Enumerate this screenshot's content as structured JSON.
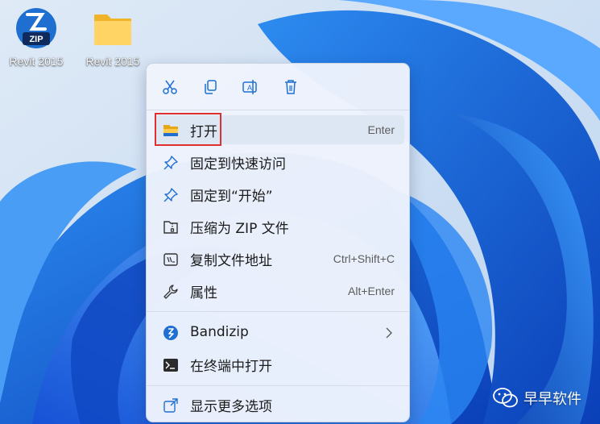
{
  "desktop": {
    "icons": [
      {
        "label": "Revit 2015",
        "icon": "zip-archive-icon"
      },
      {
        "label": "Revit 2015",
        "icon": "folder-icon"
      }
    ]
  },
  "toolbar": {
    "cut": "cut-icon",
    "copy": "copy-icon",
    "rename": "rename-icon",
    "delete": "delete-icon"
  },
  "menu": {
    "open": {
      "label": "打开",
      "shortcut": "Enter",
      "icon": "folder-open-icon"
    },
    "pin_quick": {
      "label": "固定到快速访问",
      "icon": "pin-icon"
    },
    "pin_start": {
      "label": "固定到“开始”",
      "icon": "pin-icon"
    },
    "compress": {
      "label": "压缩为 ZIP 文件",
      "icon": "zip-folder-icon"
    },
    "copy_path": {
      "label": "复制文件地址",
      "shortcut": "Ctrl+Shift+C",
      "icon": "copy-path-icon"
    },
    "properties": {
      "label": "属性",
      "shortcut": "Alt+Enter",
      "icon": "wrench-icon"
    },
    "bandizip": {
      "label": "Bandizip",
      "icon": "bandizip-icon"
    },
    "terminal": {
      "label": "在终端中打开",
      "icon": "terminal-icon"
    },
    "more": {
      "label": "显示更多选项",
      "icon": "share-icon"
    }
  },
  "watermark": {
    "text": "早早软件",
    "icon": "wechat-icon"
  },
  "colors": {
    "accent": "#1f6fd1",
    "highlight_border": "#e02f2f",
    "menu_bg": "#eef3fc"
  }
}
